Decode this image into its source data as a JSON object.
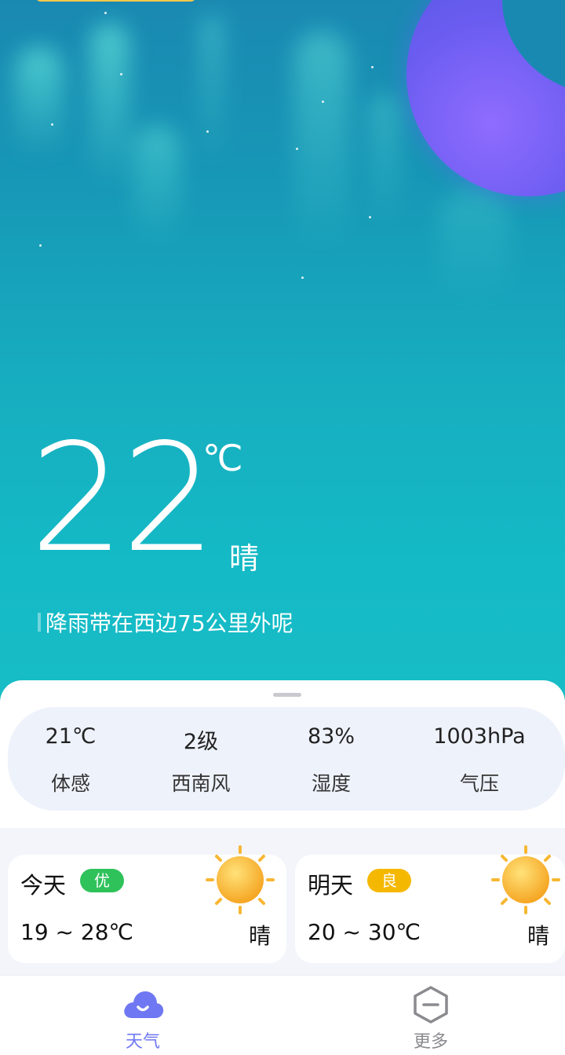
{
  "weather": {
    "temperature": "22",
    "unit": "℃",
    "condition": "晴",
    "notice": "降雨带在西边75公里外呢"
  },
  "stats": [
    {
      "value": "21℃",
      "label": "体感"
    },
    {
      "value": "2级",
      "label": "西南风"
    },
    {
      "value": "83%",
      "label": "湿度"
    },
    {
      "value": "1003hPa",
      "label": "气压"
    }
  ],
  "forecast": [
    {
      "day": "今天",
      "aqi": "优",
      "aqi_color": "#2fc25b",
      "range": "19 ~ 28℃",
      "condition": "晴",
      "icon": "sun-icon"
    },
    {
      "day": "明天",
      "aqi": "良",
      "aqi_color": "#f5b800",
      "range": "20 ~ 30℃",
      "condition": "晴",
      "icon": "sun-icon"
    }
  ],
  "tabs": [
    {
      "label": "天气",
      "icon": "cloud-smile-icon",
      "active": true,
      "color": "#6f78f2"
    },
    {
      "label": "更多",
      "icon": "hexagon-minus-icon",
      "active": false,
      "color": "#8a8a8f"
    }
  ]
}
